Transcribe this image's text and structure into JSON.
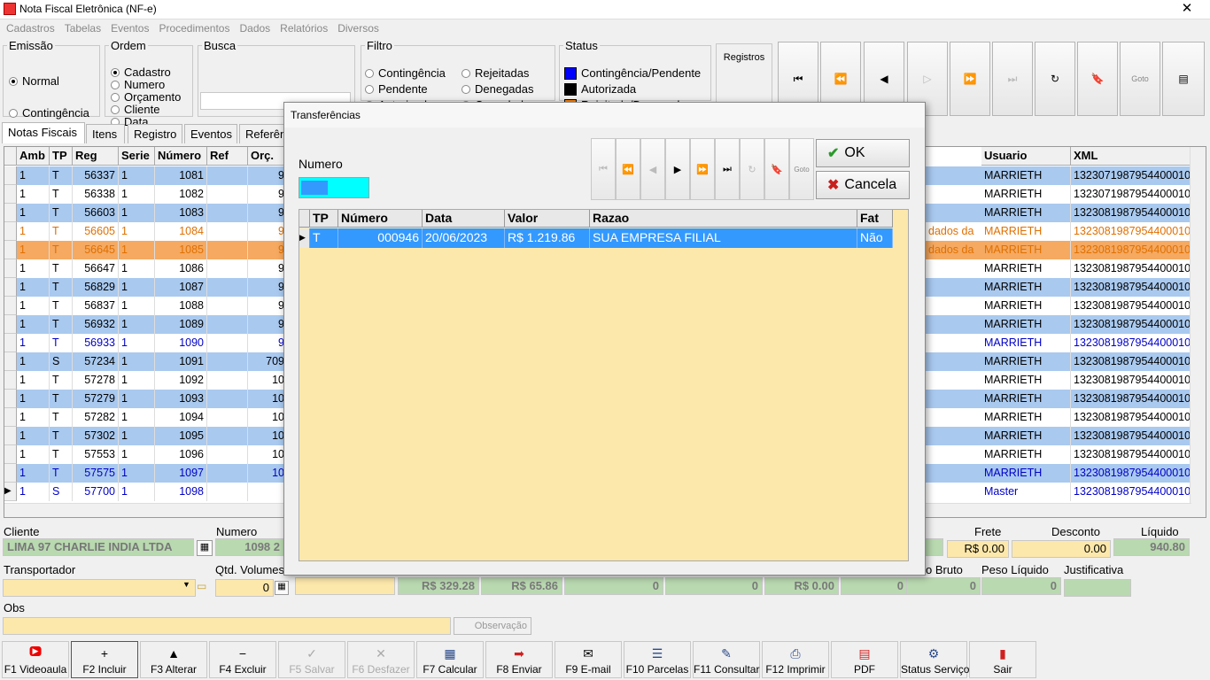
{
  "window": {
    "title": "Nota Fiscal Eletrônica (NF-e)",
    "close_glyph": "✕"
  },
  "menu": [
    "Cadastros",
    "Tabelas",
    "Eventos",
    "Procedimentos",
    "Dados",
    "Relatórios",
    "Diversos"
  ],
  "emissao": {
    "legend": "Emissão",
    "options": [
      "Normal",
      "Contingência"
    ],
    "selected": "Normal"
  },
  "ordem": {
    "legend": "Ordem",
    "options": [
      "Cadastro",
      "Numero",
      "Orçamento",
      "Cliente",
      "Data"
    ],
    "selected": "Cadastro"
  },
  "busca": {
    "legend": "Busca",
    "value": ""
  },
  "filtro": {
    "legend": "Filtro",
    "options": [
      "Contingência",
      "Pendente",
      "Autorizada",
      "Rejeitadas",
      "Denegadas",
      "Canceladas"
    ]
  },
  "status": {
    "legend": "Status",
    "items": [
      {
        "label": "Contingência/Pendente",
        "color": "#0000ff"
      },
      {
        "label": "Autorizada",
        "color": "#000000"
      },
      {
        "label": "Rejeitada/Denegada",
        "color": "#ff8000"
      }
    ]
  },
  "registros_label": "Registros",
  "nav_icons": [
    "first-icon",
    "prev-page-icon",
    "prev-icon",
    "next-icon",
    "next-page-icon",
    "last-icon",
    "refresh-icon",
    "bookmark-icon",
    "goto-icon",
    "report-icon"
  ],
  "nav_glyphs": [
    "⏮",
    "⏪",
    "◀",
    "▷",
    "⏩",
    "⏭",
    "↻",
    "🔖",
    "Goto",
    "▤"
  ],
  "tabs": [
    "Notas Fiscais",
    "Itens",
    "Registro",
    "Eventos",
    "Referên"
  ],
  "grid": {
    "left_headers": [
      "Amb",
      "TP",
      "Reg",
      "Serie",
      "Número",
      "Ref",
      "Orç."
    ],
    "right_headers": [
      "Usuario",
      "XML"
    ],
    "rows": [
      {
        "amb": "1",
        "tp": "T",
        "reg": "56337",
        "serie": "1",
        "numero": "1081",
        "orc": "9",
        "usuario": "MARRIETH",
        "xml": "13230719879544000100",
        "style": "blue",
        "note": ""
      },
      {
        "amb": "1",
        "tp": "T",
        "reg": "56338",
        "serie": "1",
        "numero": "1082",
        "orc": "9",
        "usuario": "MARRIETH",
        "xml": "13230719879544000100",
        "style": "white",
        "note": ""
      },
      {
        "amb": "1",
        "tp": "T",
        "reg": "56603",
        "serie": "1",
        "numero": "1083",
        "orc": "9",
        "usuario": "MARRIETH",
        "xml": "13230819879544000100",
        "style": "blue",
        "note": ""
      },
      {
        "amb": "1",
        "tp": "T",
        "reg": "56605",
        "serie": "1",
        "numero": "1084",
        "orc": "9",
        "usuario": "MARRIETH",
        "xml": "13230819879544000100",
        "style": "orange-text",
        "note": "dados da"
      },
      {
        "amb": "1",
        "tp": "T",
        "reg": "56645",
        "serie": "1",
        "numero": "1085",
        "orc": "9",
        "usuario": "MARRIETH",
        "xml": "13230819879544000100",
        "style": "orange-row",
        "note": "dados da"
      },
      {
        "amb": "1",
        "tp": "T",
        "reg": "56647",
        "serie": "1",
        "numero": "1086",
        "orc": "9",
        "usuario": "MARRIETH",
        "xml": "13230819879544000100",
        "style": "white",
        "note": ""
      },
      {
        "amb": "1",
        "tp": "T",
        "reg": "56829",
        "serie": "1",
        "numero": "1087",
        "orc": "9",
        "usuario": "MARRIETH",
        "xml": "13230819879544000100",
        "style": "blue",
        "note": ""
      },
      {
        "amb": "1",
        "tp": "T",
        "reg": "56837",
        "serie": "1",
        "numero": "1088",
        "orc": "9",
        "usuario": "MARRIETH",
        "xml": "13230819879544000100",
        "style": "white",
        "note": ""
      },
      {
        "amb": "1",
        "tp": "T",
        "reg": "56932",
        "serie": "1",
        "numero": "1089",
        "orc": "9",
        "usuario": "MARRIETH",
        "xml": "13230819879544000100",
        "style": "blue",
        "note": ""
      },
      {
        "amb": "1",
        "tp": "T",
        "reg": "56933",
        "serie": "1",
        "numero": "1090",
        "orc": "9",
        "usuario": "MARRIETH",
        "xml": "13230819879544000100",
        "style": "blue-text",
        "note": ""
      },
      {
        "amb": "1",
        "tp": "S",
        "reg": "57234",
        "serie": "1",
        "numero": "1091",
        "orc": "709",
        "usuario": "MARRIETH",
        "xml": "13230819879544000100",
        "style": "blue",
        "note": ""
      },
      {
        "amb": "1",
        "tp": "T",
        "reg": "57278",
        "serie": "1",
        "numero": "1092",
        "orc": "10",
        "usuario": "MARRIETH",
        "xml": "13230819879544000100",
        "style": "white",
        "note": ""
      },
      {
        "amb": "1",
        "tp": "T",
        "reg": "57279",
        "serie": "1",
        "numero": "1093",
        "orc": "10",
        "usuario": "MARRIETH",
        "xml": "13230819879544000100",
        "style": "blue",
        "note": ""
      },
      {
        "amb": "1",
        "tp": "T",
        "reg": "57282",
        "serie": "1",
        "numero": "1094",
        "orc": "10",
        "usuario": "MARRIETH",
        "xml": "13230819879544000100",
        "style": "white",
        "note": ""
      },
      {
        "amb": "1",
        "tp": "T",
        "reg": "57302",
        "serie": "1",
        "numero": "1095",
        "orc": "10",
        "usuario": "MARRIETH",
        "xml": "13230819879544000100",
        "style": "blue",
        "note": ""
      },
      {
        "amb": "1",
        "tp": "T",
        "reg": "57553",
        "serie": "1",
        "numero": "1096",
        "orc": "10",
        "usuario": "MARRIETH",
        "xml": "13230819879544000100",
        "style": "white",
        "note": ""
      },
      {
        "amb": "1",
        "tp": "T",
        "reg": "57575",
        "serie": "1",
        "numero": "1097",
        "orc": "10",
        "usuario": "MARRIETH",
        "xml": "13230819879544000100",
        "style": "blue-row-text",
        "note": ""
      },
      {
        "amb": "1",
        "tp": "S",
        "reg": "57700",
        "serie": "1",
        "numero": "1098",
        "orc": "",
        "usuario": "Master",
        "xml": "13230819879544000100",
        "style": "current",
        "note": ""
      }
    ]
  },
  "cliente": {
    "label": "Cliente",
    "value": "LIMA 97 CHARLIE INDIA LTDA"
  },
  "numero": {
    "label": "Numero",
    "value": "1098 2"
  },
  "frete": {
    "label": "Frete",
    "value": "R$ 0.00"
  },
  "desconto": {
    "label": "Desconto",
    "value": "0.00"
  },
  "liquido": {
    "label": "Líquido",
    "value": "940.80"
  },
  "transportador": {
    "label": "Transportador",
    "value": ""
  },
  "qtd_volumes": {
    "label": "Qtd. Volumes",
    "value": "0"
  },
  "totals": [
    "R$ 329.28",
    "R$ 65.86",
    "0",
    "0",
    "R$ 0.00",
    "0"
  ],
  "peso_bruto": {
    "label": "o Bruto",
    "value": "0"
  },
  "peso_liquido": {
    "label": "Peso Líquido",
    "value": "0"
  },
  "justificativa": {
    "label": "Justificativa",
    "value": ""
  },
  "obs": {
    "label": "Obs",
    "value": "",
    "button": "Observação"
  },
  "fkeys": [
    {
      "label": "F1 Videoaula",
      "icon": "youtube-icon",
      "glyph": "▶",
      "enabled": true
    },
    {
      "label": "F2 Incluir",
      "icon": "plus-icon",
      "glyph": "+",
      "enabled": true
    },
    {
      "label": "F3 Alterar",
      "icon": "up-triangle-icon",
      "glyph": "▲",
      "enabled": true
    },
    {
      "label": "F4 Excluir",
      "icon": "minus-icon",
      "glyph": "−",
      "enabled": true
    },
    {
      "label": "F5 Salvar",
      "icon": "check-icon",
      "glyph": "✓",
      "enabled": false
    },
    {
      "label": "F6 Desfazer",
      "icon": "x-icon",
      "glyph": "✕",
      "enabled": false
    },
    {
      "label": "F7 Calcular",
      "icon": "calculator-icon",
      "glyph": "▦",
      "enabled": true
    },
    {
      "label": "F8 Enviar",
      "icon": "send-icon",
      "glyph": "➡",
      "enabled": true
    },
    {
      "label": "F9 E-mail",
      "icon": "email-icon",
      "glyph": "✉",
      "enabled": true
    },
    {
      "label": "F10 Parcelas",
      "icon": "list-icon",
      "glyph": "☰",
      "enabled": true
    },
    {
      "label": "F11 Consultar",
      "icon": "consult-icon",
      "glyph": "✎",
      "enabled": true
    },
    {
      "label": "F12 Imprimir",
      "icon": "printer-icon",
      "glyph": "⎙",
      "enabled": true
    },
    {
      "label": "PDF",
      "icon": "pdf-icon",
      "glyph": "▤",
      "enabled": true
    },
    {
      "label": "Status Serviço",
      "icon": "status-icon",
      "glyph": "⚙",
      "enabled": true
    },
    {
      "label": "Sair",
      "icon": "exit-icon",
      "glyph": "▮",
      "enabled": true
    }
  ],
  "dialog": {
    "title": "Transferências",
    "numero_label": "Numero",
    "numero_value": "",
    "nav_glyphs": [
      "⏮",
      "⏪",
      "◀",
      "▶",
      "⏩",
      "⏭",
      "↻",
      "🔖",
      "Goto"
    ],
    "ok_label": "OK",
    "cancel_label": "Cancela",
    "headers": [
      "TP",
      "Número",
      "Data",
      "Valor",
      "Razao",
      "Fat"
    ],
    "rows": [
      {
        "tp": "T",
        "numero": "000946",
        "data": "20/06/2023",
        "valor": "R$ 1.219.86",
        "razao": "SUA EMPRESA FILIAL",
        "fat": "Não"
      }
    ]
  }
}
